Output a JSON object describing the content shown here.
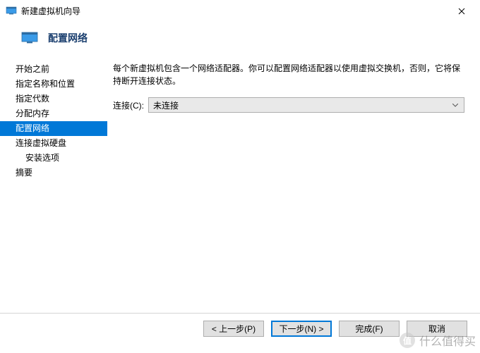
{
  "window": {
    "title": "新建虚拟机向导"
  },
  "header": {
    "title": "配置网络"
  },
  "sidebar": {
    "items": [
      {
        "label": "开始之前",
        "indent": false
      },
      {
        "label": "指定名称和位置",
        "indent": false
      },
      {
        "label": "指定代数",
        "indent": false
      },
      {
        "label": "分配内存",
        "indent": false
      },
      {
        "label": "配置网络",
        "indent": false,
        "selected": true
      },
      {
        "label": "连接虚拟硬盘",
        "indent": false
      },
      {
        "label": "安装选项",
        "indent": true
      },
      {
        "label": "摘要",
        "indent": false
      }
    ]
  },
  "main": {
    "description": "每个新虚拟机包含一个网络适配器。你可以配置网络适配器以使用虚拟交换机，否则，它将保持断开连接状态。",
    "connection_label": "连接(C):",
    "connection_value": "未连接"
  },
  "footer": {
    "prev": "< 上一步(P)",
    "next": "下一步(N) >",
    "finish": "完成(F)",
    "cancel": "取消"
  },
  "watermark": {
    "text": "什么值得买",
    "badge": "值"
  }
}
